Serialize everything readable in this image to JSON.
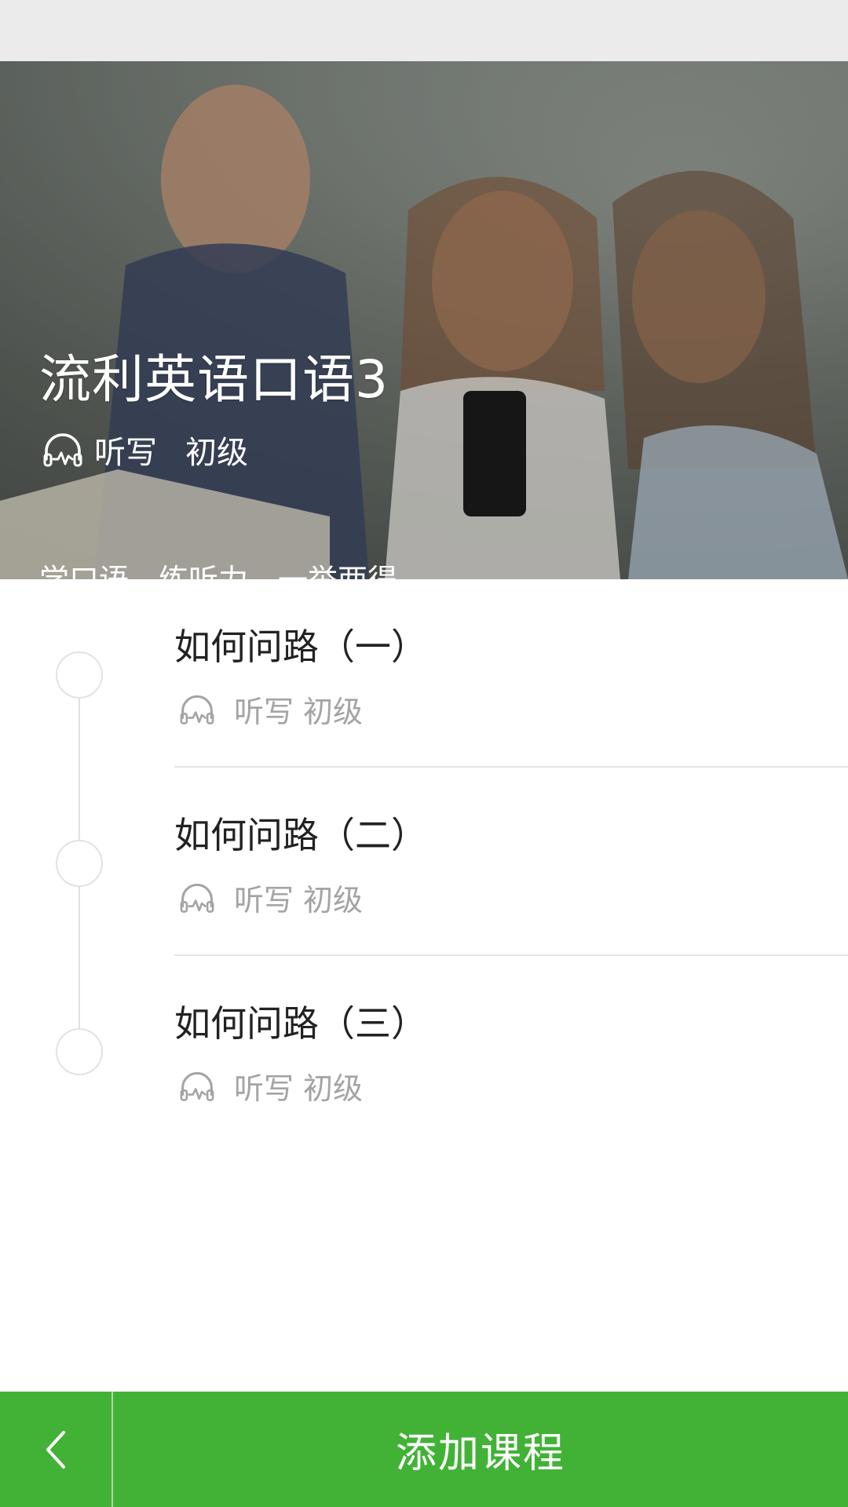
{
  "course": {
    "title": "流利英语口语3",
    "type": "听写",
    "level": "初级",
    "subtitle": "学口语，练听力，一举两得",
    "type_icon": "headphones-wave-icon"
  },
  "lessons": [
    {
      "title": "如何问路（一）",
      "type": "听写",
      "level": "初级"
    },
    {
      "title": "如何问路（二）",
      "type": "听写",
      "level": "初级"
    },
    {
      "title": "如何问路（三）",
      "type": "听写",
      "level": "初级"
    }
  ],
  "bottom_bar": {
    "back_icon": "chevron-left-icon",
    "add_label": "添加课程"
  },
  "colors": {
    "accent": "#42b236",
    "status_bar": "#ebebeb",
    "muted_text": "#a4a4a4"
  }
}
